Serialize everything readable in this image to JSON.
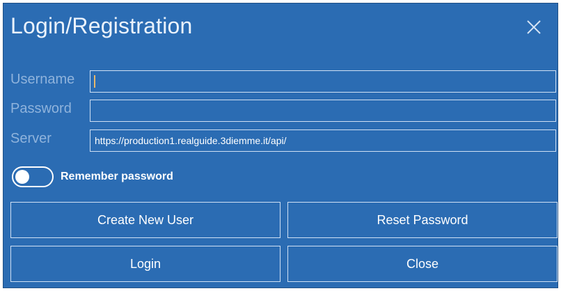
{
  "dialog": {
    "title": "Login/Registration",
    "close_icon": "close-icon",
    "background_color": "#2b6cb3"
  },
  "form": {
    "username": {
      "label": "Username",
      "value": ""
    },
    "password": {
      "label": "Password",
      "value": ""
    },
    "server": {
      "label": "Server",
      "value": "https://production1.realguide.3diemme.it/api/"
    }
  },
  "remember": {
    "label": "Remember password",
    "checked": false
  },
  "buttons": {
    "create_user": "Create New User",
    "reset_password": "Reset Password",
    "login": "Login",
    "close": "Close"
  }
}
